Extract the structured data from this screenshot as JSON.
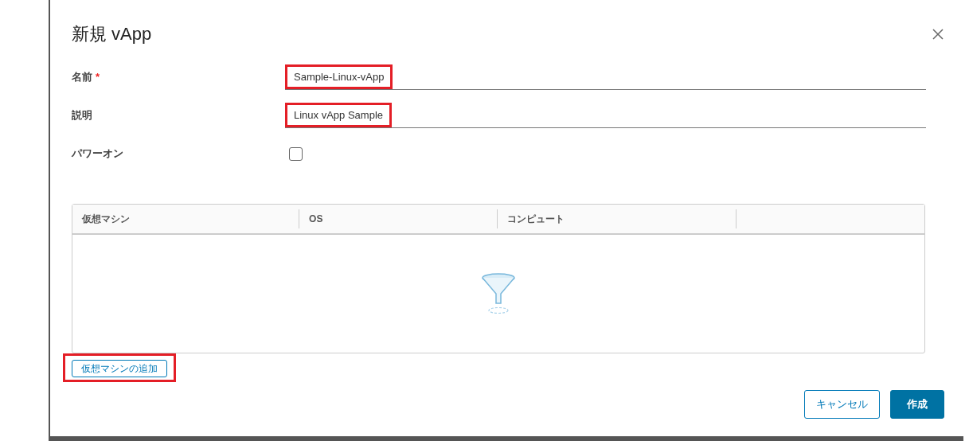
{
  "dialog": {
    "title": "新規 vApp"
  },
  "fields": [
    {
      "kind": "text",
      "label": "名前",
      "required_mark": "*",
      "value": "Sample-Linux-vApp",
      "highlighted": true
    },
    {
      "kind": "text",
      "label": "説明",
      "value": "Linux vApp Sample",
      "highlighted": true
    },
    {
      "kind": "checkbox",
      "label": "パワーオン",
      "checked": false
    }
  ],
  "table": {
    "columns": [
      "仮想マシン",
      "OS",
      "コンピュート",
      ""
    ]
  },
  "add_button": {
    "label": "仮想マシンの追加",
    "highlighted": true
  },
  "buttons": [
    {
      "label": "キャンセル",
      "kind": "secondary"
    },
    {
      "label": "作成",
      "kind": "primary"
    }
  ]
}
